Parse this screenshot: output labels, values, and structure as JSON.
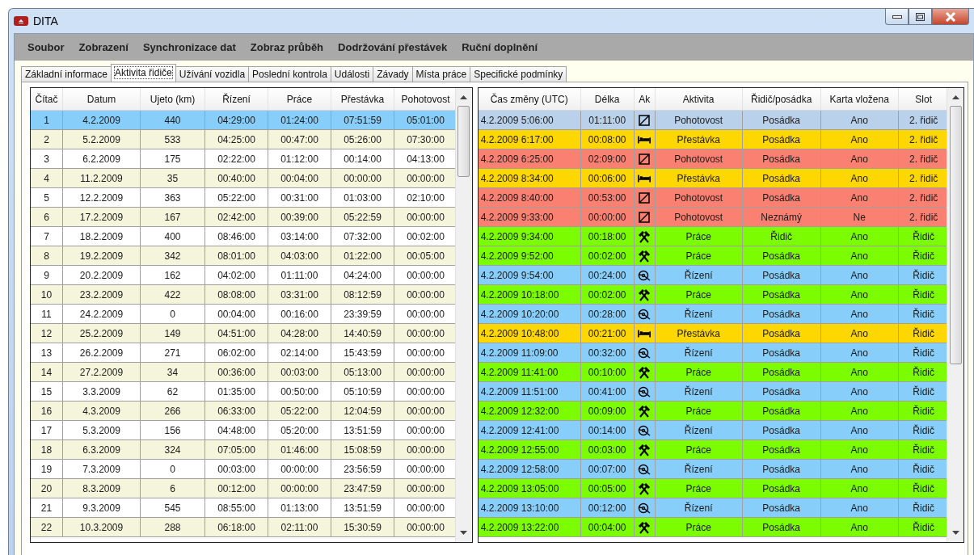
{
  "window": {
    "title": "DITA"
  },
  "menu": [
    "Soubor",
    "Zobrazení",
    "Synchronizace dat",
    "Zobraz průběh",
    "Dodržování přestávek",
    "Ruční doplnění"
  ],
  "tabs": [
    {
      "label": "Základní informace",
      "selected": false
    },
    {
      "label": "Aktivita řidiče",
      "selected": true
    },
    {
      "label": "Užívání vozidla",
      "selected": false
    },
    {
      "label": "Poslední kontrola",
      "selected": false
    },
    {
      "label": "Události",
      "selected": false
    },
    {
      "label": "Závady",
      "selected": false
    },
    {
      "label": "Místa práce",
      "selected": false
    },
    {
      "label": "Specifické podmínky",
      "selected": false
    }
  ],
  "activity_table": {
    "columns": [
      "Čítač",
      "Datum",
      "Ujeto (km)",
      "Řízení",
      "Práce",
      "Přestávka",
      "Pohotovost"
    ],
    "rows": [
      {
        "cells": [
          "1",
          "4.2.2009",
          "440",
          "04:29:00",
          "01:24:00",
          "07:51:59",
          "05:01:00"
        ],
        "selected": true
      },
      {
        "cells": [
          "2",
          "5.2.2009",
          "533",
          "04:25:00",
          "00:47:00",
          "05:26:00",
          "07:30:00"
        ],
        "selected": false
      },
      {
        "cells": [
          "3",
          "6.2.2009",
          "175",
          "02:22:00",
          "01:12:00",
          "00:14:00",
          "04:13:00"
        ],
        "selected": false
      },
      {
        "cells": [
          "4",
          "11.2.2009",
          "35",
          "00:40:00",
          "00:04:00",
          "00:00:00",
          "00:00:00"
        ],
        "selected": false
      },
      {
        "cells": [
          "5",
          "12.2.2009",
          "363",
          "05:22:00",
          "00:31:00",
          "01:03:00",
          "02:10:00"
        ],
        "selected": false
      },
      {
        "cells": [
          "6",
          "17.2.2009",
          "167",
          "02:42:00",
          "00:39:00",
          "05:22:59",
          "00:00:00"
        ],
        "selected": false
      },
      {
        "cells": [
          "7",
          "18.2.2009",
          "400",
          "08:46:00",
          "03:14:00",
          "07:32:00",
          "00:02:00"
        ],
        "selected": false
      },
      {
        "cells": [
          "8",
          "19.2.2009",
          "342",
          "08:01:00",
          "04:03:00",
          "01:22:00",
          "00:05:00"
        ],
        "selected": false
      },
      {
        "cells": [
          "9",
          "20.2.2009",
          "162",
          "04:02:00",
          "01:11:00",
          "04:24:00",
          "00:00:00"
        ],
        "selected": false
      },
      {
        "cells": [
          "10",
          "23.2.2009",
          "422",
          "08:08:00",
          "03:31:00",
          "08:12:59",
          "00:00:00"
        ],
        "selected": false
      },
      {
        "cells": [
          "11",
          "24.2.2009",
          "0",
          "00:04:00",
          "00:16:00",
          "23:39:59",
          "00:00:00"
        ],
        "selected": false
      },
      {
        "cells": [
          "12",
          "25.2.2009",
          "149",
          "04:51:00",
          "04:28:00",
          "14:40:59",
          "00:00:00"
        ],
        "selected": false
      },
      {
        "cells": [
          "13",
          "26.2.2009",
          "271",
          "06:02:00",
          "02:14:00",
          "15:43:59",
          "00:00:00"
        ],
        "selected": false
      },
      {
        "cells": [
          "14",
          "27.2.2009",
          "34",
          "00:36:00",
          "00:03:00",
          "05:13:00",
          "00:00:00"
        ],
        "selected": false
      },
      {
        "cells": [
          "15",
          "3.3.2009",
          "62",
          "01:35:00",
          "00:50:00",
          "05:10:59",
          "00:00:00"
        ],
        "selected": false
      },
      {
        "cells": [
          "16",
          "4.3.2009",
          "266",
          "06:33:00",
          "05:22:00",
          "12:04:59",
          "00:00:00"
        ],
        "selected": false
      },
      {
        "cells": [
          "17",
          "5.3.2009",
          "156",
          "04:48:00",
          "05:20:00",
          "13:51:59",
          "00:00:00"
        ],
        "selected": false
      },
      {
        "cells": [
          "18",
          "6.3.2009",
          "324",
          "07:05:00",
          "01:46:00",
          "15:08:59",
          "00:00:00"
        ],
        "selected": false
      },
      {
        "cells": [
          "19",
          "7.3.2009",
          "0",
          "00:03:00",
          "00:00:00",
          "23:56:59",
          "00:00:00"
        ],
        "selected": false
      },
      {
        "cells": [
          "20",
          "8.3.2009",
          "6",
          "00:12:00",
          "00:00:00",
          "23:47:59",
          "00:00:00"
        ],
        "selected": false
      },
      {
        "cells": [
          "21",
          "9.3.2009",
          "545",
          "08:55:00",
          "01:13:00",
          "13:51:59",
          "00:00:00"
        ],
        "selected": false
      },
      {
        "cells": [
          "22",
          "10.3.2009",
          "288",
          "06:18:00",
          "02:11:00",
          "15:30:59",
          "00:00:00"
        ],
        "selected": false
      }
    ]
  },
  "changes_table": {
    "columns": [
      "Čas změny (UTC)",
      "Délka",
      "Ak",
      "Aktivita",
      "Řidič/posádka",
      "Karta vložena",
      "Slot"
    ],
    "rows": [
      {
        "kind": "standby",
        "time": "4.2.2009 5:06:00",
        "duration": "01:11:00",
        "activity": "Pohotovost",
        "crew": "Posádka",
        "card": "Ano",
        "slot": "2. řidič",
        "selected": true
      },
      {
        "kind": "break",
        "time": "4.2.2009 6:17:00",
        "duration": "00:08:00",
        "activity": "Přestávka",
        "crew": "Posádka",
        "card": "Ano",
        "slot": "2. řidič",
        "selected": false
      },
      {
        "kind": "standby",
        "time": "4.2.2009 6:25:00",
        "duration": "02:09:00",
        "activity": "Pohotovost",
        "crew": "Posádka",
        "card": "Ano",
        "slot": "2. řidič",
        "selected": false
      },
      {
        "kind": "break",
        "time": "4.2.2009 8:34:00",
        "duration": "00:06:00",
        "activity": "Přestávka",
        "crew": "Posádka",
        "card": "Ano",
        "slot": "2. řidič",
        "selected": false
      },
      {
        "kind": "standby",
        "time": "4.2.2009 8:40:00",
        "duration": "00:53:00",
        "activity": "Pohotovost",
        "crew": "Posádka",
        "card": "Ano",
        "slot": "2. řidič",
        "selected": false
      },
      {
        "kind": "standby",
        "time": "4.2.2009 9:33:00",
        "duration": "00:00:00",
        "activity": "Pohotovost",
        "crew": "Neznámý",
        "card": "Ne",
        "slot": "2. řidič",
        "selected": false
      },
      {
        "kind": "work",
        "time": "4.2.2009 9:34:00",
        "duration": "00:18:00",
        "activity": "Práce",
        "crew": "Řidič",
        "card": "Ano",
        "slot": "Řidič",
        "selected": false
      },
      {
        "kind": "work",
        "time": "4.2.2009 9:52:00",
        "duration": "00:02:00",
        "activity": "Práce",
        "crew": "Posádka",
        "card": "Ano",
        "slot": "Řidič",
        "selected": false
      },
      {
        "kind": "driving",
        "time": "4.2.2009 9:54:00",
        "duration": "00:24:00",
        "activity": "Řízení",
        "crew": "Posádka",
        "card": "Ano",
        "slot": "Řidič",
        "selected": false
      },
      {
        "kind": "work",
        "time": "4.2.2009 10:18:00",
        "duration": "00:02:00",
        "activity": "Práce",
        "crew": "Posádka",
        "card": "Ano",
        "slot": "Řidič",
        "selected": false
      },
      {
        "kind": "driving",
        "time": "4.2.2009 10:20:00",
        "duration": "00:28:00",
        "activity": "Řízení",
        "crew": "Posádka",
        "card": "Ano",
        "slot": "Řidič",
        "selected": false
      },
      {
        "kind": "break",
        "time": "4.2.2009 10:48:00",
        "duration": "00:21:00",
        "activity": "Přestávka",
        "crew": "Posádka",
        "card": "Ano",
        "slot": "Řidič",
        "selected": false
      },
      {
        "kind": "driving",
        "time": "4.2.2009 11:09:00",
        "duration": "00:32:00",
        "activity": "Řízení",
        "crew": "Posádka",
        "card": "Ano",
        "slot": "Řidič",
        "selected": false
      },
      {
        "kind": "work",
        "time": "4.2.2009 11:41:00",
        "duration": "00:10:00",
        "activity": "Práce",
        "crew": "Posádka",
        "card": "Ano",
        "slot": "Řidič",
        "selected": false
      },
      {
        "kind": "driving",
        "time": "4.2.2009 11:51:00",
        "duration": "00:41:00",
        "activity": "Řízení",
        "crew": "Posádka",
        "card": "Ano",
        "slot": "Řidič",
        "selected": false
      },
      {
        "kind": "work",
        "time": "4.2.2009 12:32:00",
        "duration": "00:09:00",
        "activity": "Práce",
        "crew": "Posádka",
        "card": "Ano",
        "slot": "Řidič",
        "selected": false
      },
      {
        "kind": "driving",
        "time": "4.2.2009 12:41:00",
        "duration": "00:14:00",
        "activity": "Řízení",
        "crew": "Posádka",
        "card": "Ano",
        "slot": "Řidič",
        "selected": false
      },
      {
        "kind": "work",
        "time": "4.2.2009 12:55:00",
        "duration": "00:03:00",
        "activity": "Práce",
        "crew": "Posádka",
        "card": "Ano",
        "slot": "Řidič",
        "selected": false
      },
      {
        "kind": "driving",
        "time": "4.2.2009 12:58:00",
        "duration": "00:07:00",
        "activity": "Řízení",
        "crew": "Posádka",
        "card": "Ano",
        "slot": "Řidič",
        "selected": false
      },
      {
        "kind": "work",
        "time": "4.2.2009 13:05:00",
        "duration": "00:05:00",
        "activity": "Práce",
        "crew": "Posádka",
        "card": "Ano",
        "slot": "Řidič",
        "selected": false
      },
      {
        "kind": "driving",
        "time": "4.2.2009 13:10:00",
        "duration": "00:12:00",
        "activity": "Řízení",
        "crew": "Posádka",
        "card": "Ano",
        "slot": "Řidič",
        "selected": false
      },
      {
        "kind": "work",
        "time": "4.2.2009 13:22:00",
        "duration": "00:04:00",
        "activity": "Práce",
        "crew": "Posádka",
        "card": "Ano",
        "slot": "Řidič",
        "selected": false
      }
    ]
  }
}
